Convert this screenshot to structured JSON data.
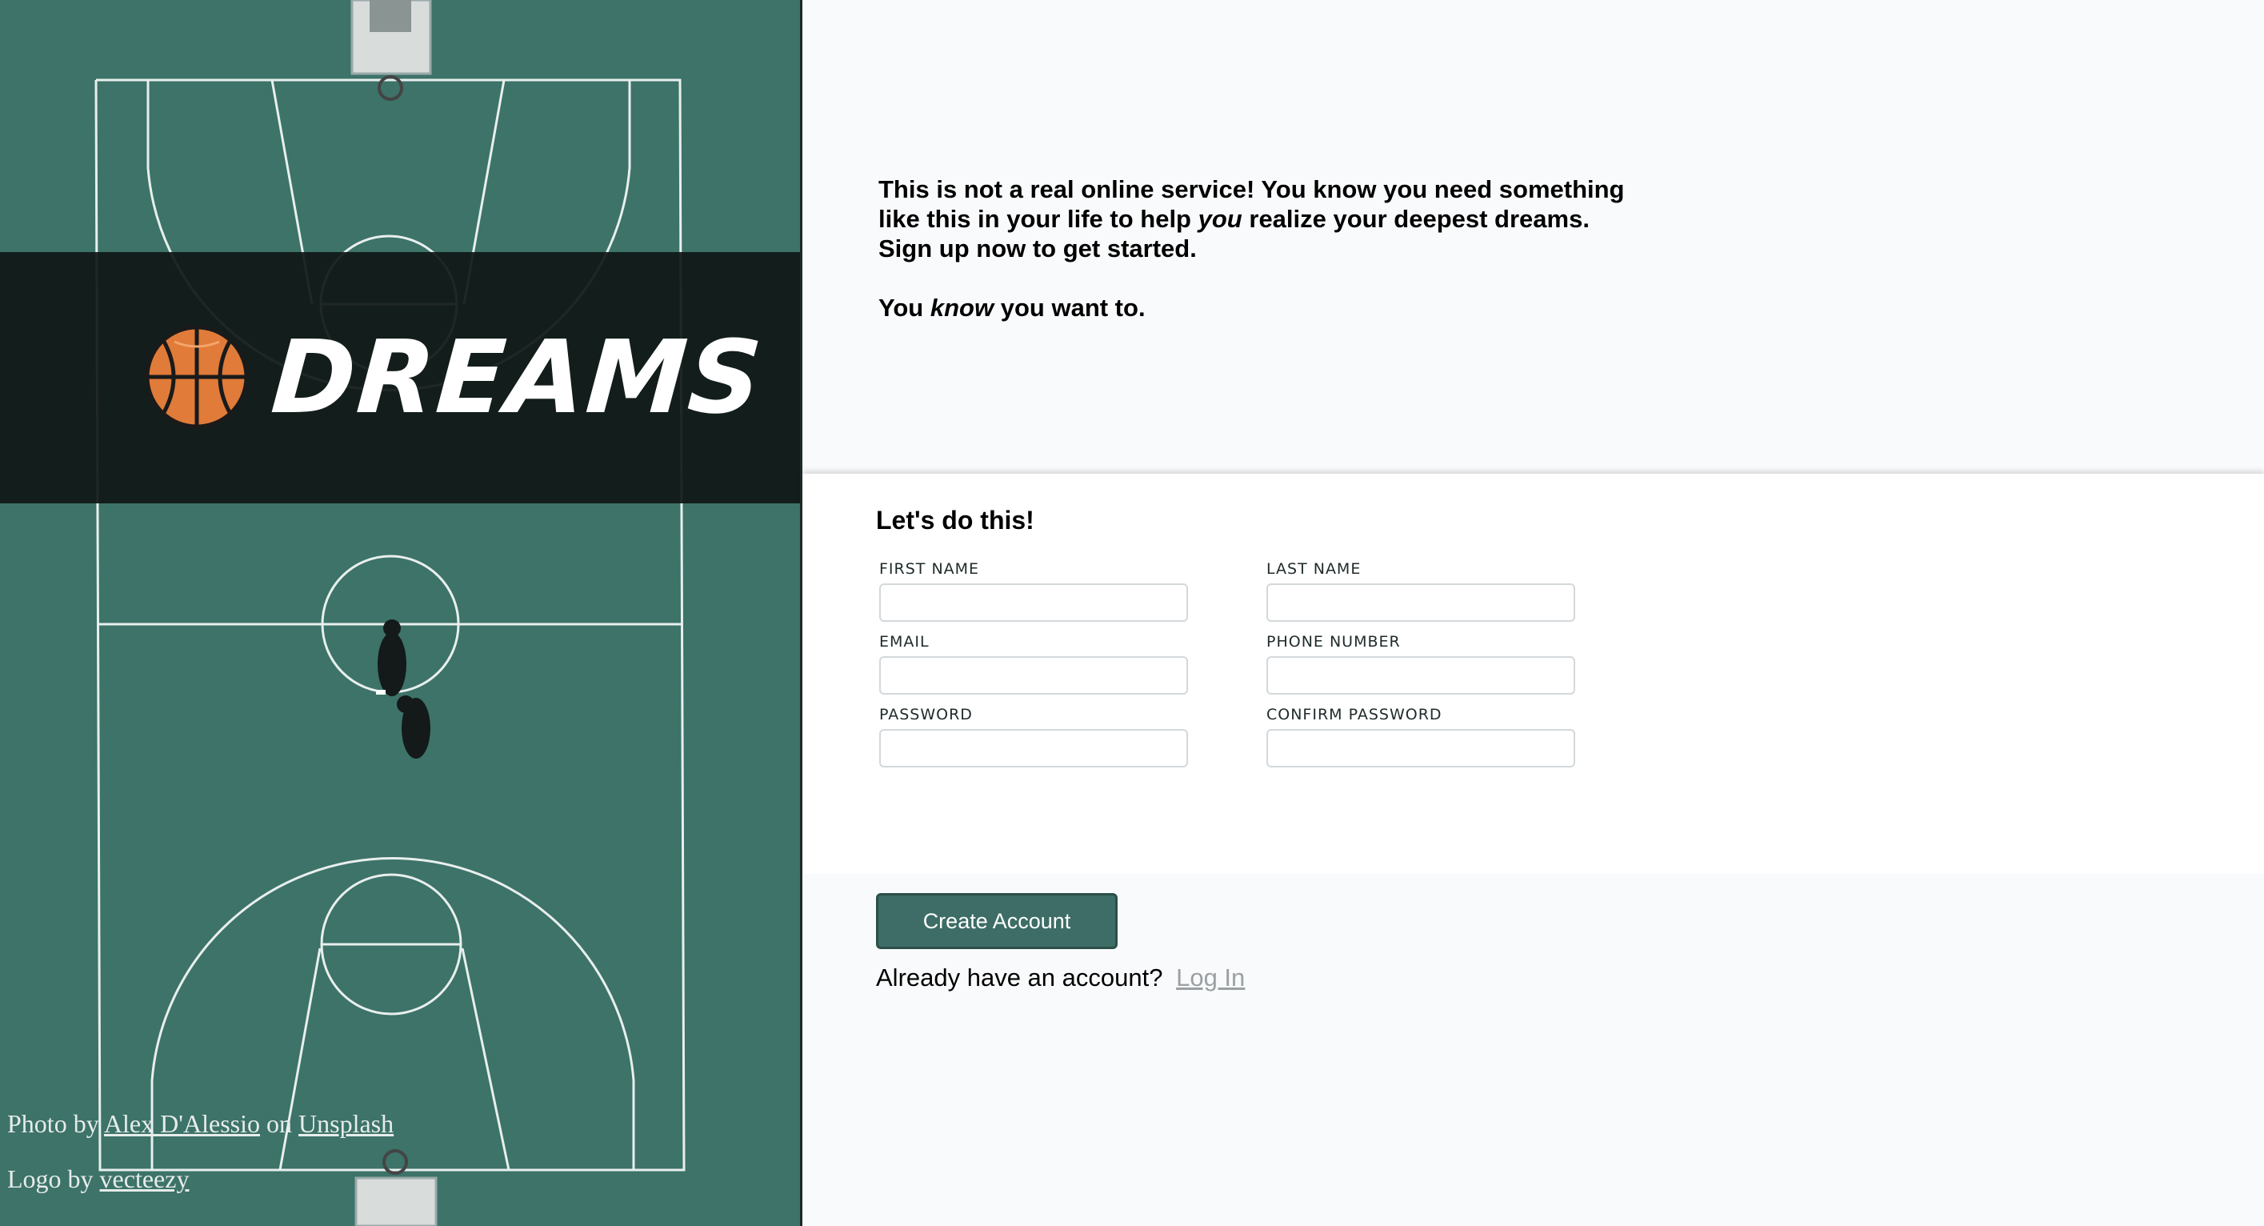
{
  "hero": {
    "logo_text": "DREAMS",
    "logo_icon": "basketball-icon",
    "photo_credit": {
      "prefix": "Photo by",
      "author": "Alex D'Alessio",
      "middle": "on",
      "site": "Unsplash"
    },
    "logo_credit": {
      "prefix": "Logo by",
      "author": "vecteezy"
    }
  },
  "intro": {
    "line1": "This is not a real online service! You know you need something",
    "line2_before": "like this in your life to help",
    "line2_em": "you",
    "line2_after": "realize your deepest dreams.",
    "line3": "Sign up now to get started.",
    "line4_before": "You",
    "line4_em": "know",
    "line4_after": "you want to."
  },
  "form": {
    "title": "Let's do this!",
    "fields": {
      "first_name": {
        "label": "FIRST NAME",
        "value": ""
      },
      "last_name": {
        "label": "LAST NAME",
        "value": ""
      },
      "email": {
        "label": "EMAIL",
        "value": ""
      },
      "phone": {
        "label": "PHONE NUMBER",
        "value": ""
      },
      "password": {
        "label": "PASSWORD",
        "value": ""
      },
      "confirm_password": {
        "label": "CONFIRM PASSWORD",
        "value": ""
      }
    }
  },
  "actions": {
    "create_label": "Create Account",
    "login_prompt": "Already have an account?",
    "login_link": "Log In"
  },
  "colors": {
    "court": "#3d7369",
    "button": "#3d6d66",
    "band": "#101817",
    "ball": "#e07b39"
  }
}
